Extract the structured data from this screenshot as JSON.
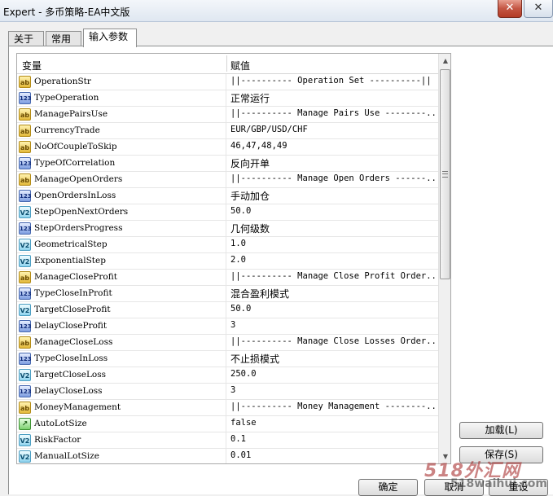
{
  "window": {
    "title": "Expert - 多币策略-EA中文版",
    "close_label": "✕",
    "max_label": "✕"
  },
  "tabs": [
    {
      "label": "关于"
    },
    {
      "label": "常用"
    },
    {
      "label": "输入参数"
    }
  ],
  "table": {
    "col_variable": "变量",
    "col_value": "赋值",
    "rows": [
      {
        "type": "ab",
        "icon": "ab",
        "name": "OperationStr",
        "value": "||---------- Operation Set ----------||"
      },
      {
        "type": "n123",
        "icon": "123",
        "name": "TypeOperation",
        "value": "正常运行"
      },
      {
        "type": "ab",
        "icon": "ab",
        "name": "ManagePairsUse",
        "value": "||---------- Manage Pairs Use --------..."
      },
      {
        "type": "ab",
        "icon": "ab",
        "name": "CurrencyTrade",
        "value": "EUR/GBP/USD/CHF"
      },
      {
        "type": "ab",
        "icon": "ab",
        "name": "NoOfCoupleToSkip",
        "value": "46,47,48,49"
      },
      {
        "type": "n123",
        "icon": "123",
        "name": "TypeOfCorrelation",
        "value": "反向开单"
      },
      {
        "type": "ab",
        "icon": "ab",
        "name": "ManageOpenOrders",
        "value": "||---------- Manage Open Orders ------..."
      },
      {
        "type": "n123",
        "icon": "123",
        "name": "OpenOrdersInLoss",
        "value": "手动加仓"
      },
      {
        "type": "v2",
        "icon": "V2",
        "name": "StepOpenNextOrders",
        "value": "50.0"
      },
      {
        "type": "n123",
        "icon": "123",
        "name": "StepOrdersProgress",
        "value": "几何级数"
      },
      {
        "type": "v2",
        "icon": "V2",
        "name": "GeometricalStep",
        "value": "1.0"
      },
      {
        "type": "v2",
        "icon": "V2",
        "name": "ExponentialStep",
        "value": "2.0"
      },
      {
        "type": "ab",
        "icon": "ab",
        "name": "ManageCloseProfit",
        "value": "||---------- Manage Close Profit Order..."
      },
      {
        "type": "n123",
        "icon": "123",
        "name": "TypeCloseInProfit",
        "value": "混合盈利模式"
      },
      {
        "type": "v2",
        "icon": "V2",
        "name": "TargetCloseProfit",
        "value": "50.0"
      },
      {
        "type": "n123",
        "icon": "123",
        "name": "DelayCloseProfit",
        "value": "3"
      },
      {
        "type": "ab",
        "icon": "ab",
        "name": "ManageCloseLoss",
        "value": "||---------- Manage Close Losses Order..."
      },
      {
        "type": "n123",
        "icon": "123",
        "name": "TypeCloseInLoss",
        "value": "不止损模式"
      },
      {
        "type": "v2",
        "icon": "V2",
        "name": "TargetCloseLoss",
        "value": "250.0"
      },
      {
        "type": "n123",
        "icon": "123",
        "name": "DelayCloseLoss",
        "value": "3"
      },
      {
        "type": "ab",
        "icon": "ab",
        "name": "MoneyManagement",
        "value": "||---------- Money Management --------..."
      },
      {
        "type": "bool",
        "icon": "↗",
        "name": "AutoLotSize",
        "value": "false"
      },
      {
        "type": "v2",
        "icon": "V2",
        "name": "RiskFactor",
        "value": "0.1"
      },
      {
        "type": "v2",
        "icon": "V2",
        "name": "ManualLotSize",
        "value": "0.01"
      }
    ]
  },
  "buttons": {
    "load": "加载(L)",
    "save": "保存(S)",
    "ok": "确定",
    "cancel": "取消",
    "reset": "重设"
  },
  "watermark": {
    "text": "518外汇网",
    "sub": "518waihui.com"
  }
}
